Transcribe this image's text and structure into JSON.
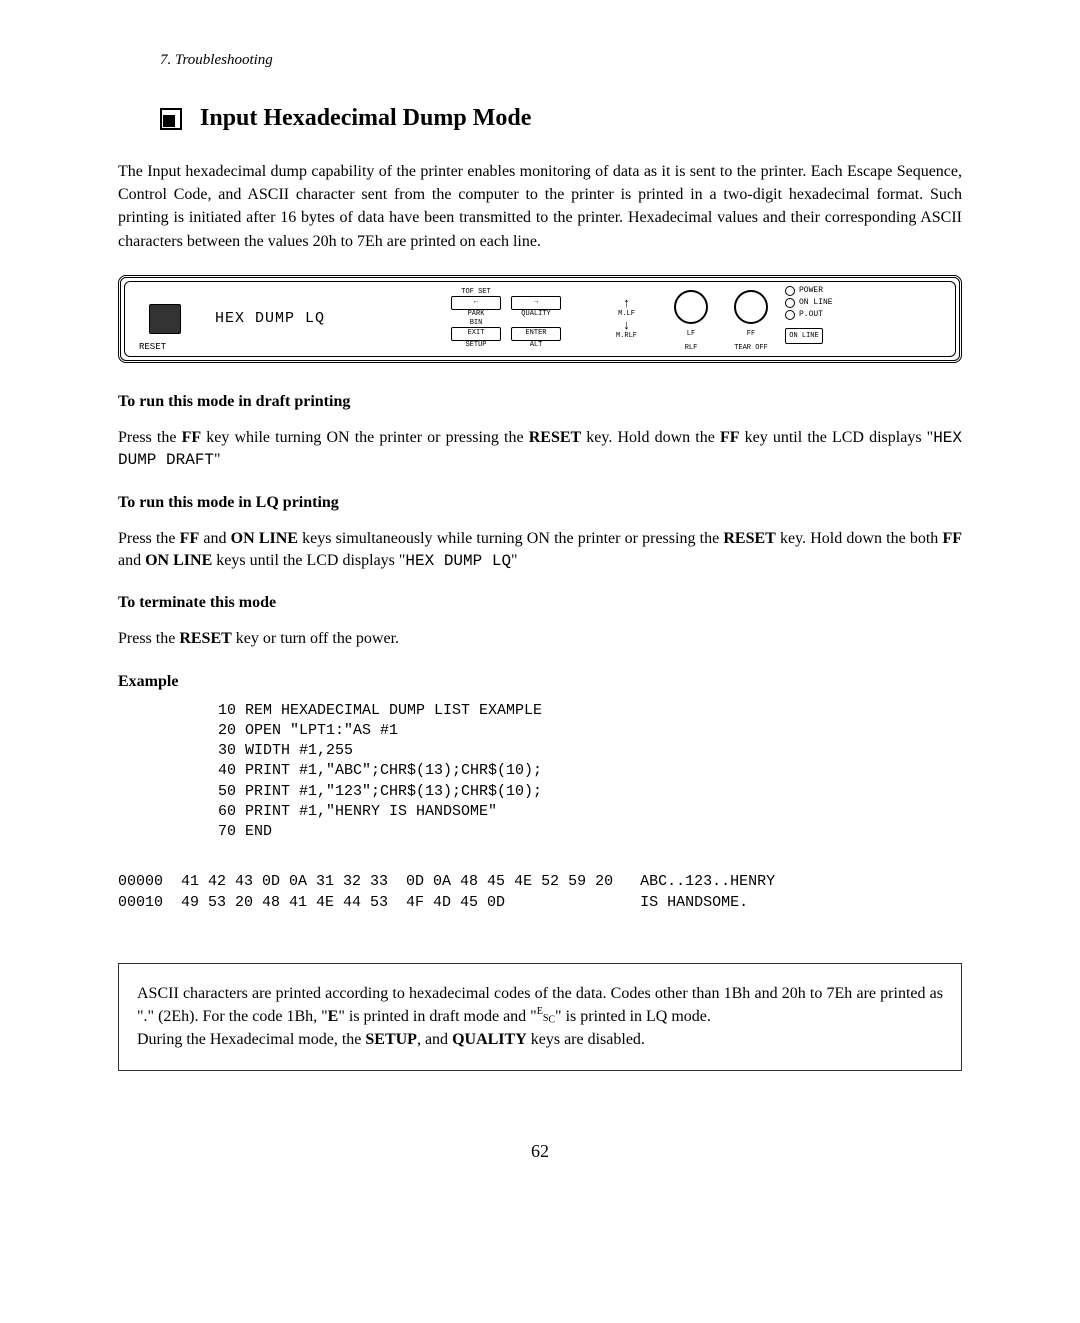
{
  "breadcrumb": "7. Troubleshooting",
  "title": "Input Hexadecimal Dump Mode",
  "intro": "The Input hexadecimal dump capability of the printer enables monitoring of data as it is sent to the printer.  Each Escape Sequence, Control Code, and ASCII character sent from the computer to the printer is printed in a two-digit hexadecimal format.  Such printing is initiated after 16 bytes of data have been transmitted to the printer.  Hexadecimal values and their corresponding ASCII characters between the values 20h to 7Eh are printed on each line.",
  "figure": {
    "reset_label": "RESET",
    "lcd": "HEX DUMP   LQ",
    "buttons": {
      "tof_set": "TOF SET",
      "left_arrow": "←",
      "right_arrow": "→",
      "park": "PARK",
      "quality": "QUALITY",
      "bin": "BIN",
      "exit": "EXIT",
      "enter": "ENTER",
      "setup": "SETUP",
      "alt": "ALT"
    },
    "arrows": {
      "up": "↑",
      "down": "↓",
      "mlf": "M.LF",
      "mrlf": "M.RLF"
    },
    "round": {
      "lf": "LF",
      "ff": "FF",
      "rlf": "RLF",
      "tearoff": "TEAR OFF",
      "online": "ON LINE"
    },
    "leds": {
      "power": "POWER",
      "online": "ON LINE",
      "pout": "P.OUT"
    }
  },
  "sections": {
    "draft_head": "To run this mode in draft printing",
    "draft_pre": "Press the ",
    "draft_ff": "FF",
    "draft_mid1": " key while turning ON the printer or pressing the ",
    "draft_reset": "RESET",
    "draft_mid2": " key.  Hold down the ",
    "draft_ff2": "FF",
    "draft_mid3": " key until the LCD displays \"",
    "draft_lcd": "HEX DUMP  DRAFT",
    "draft_end": "\"",
    "lq_head": "To run this mode in LQ printing",
    "lq_pre": "Press the ",
    "lq_ff": "FF",
    "lq_and": " and ",
    "lq_online": "ON LINE",
    "lq_mid1": " keys simultaneously while turning ON the printer or pressing the ",
    "lq_reset": "RESET",
    "lq_mid2": " key.  Hold down the both ",
    "lq_ff2": "FF",
    "lq_and2": " and ",
    "lq_online2": "ON LINE",
    "lq_mid3": " keys until the LCD displays \"",
    "lq_lcd": "HEX DUMP LQ",
    "lq_end": "\"",
    "term_head": "To terminate this mode",
    "term_pre": "Press the ",
    "term_reset": "RESET",
    "term_end": " key or turn off the power.",
    "example_head": "Example",
    "code": "10 REM HEXADECIMAL DUMP LIST EXAMPLE\n20 OPEN \"LPT1:\"AS #1\n30 WIDTH #1,255\n40 PRINT #1,\"ABC\";CHR$(13);CHR$(10);\n50 PRINT #1,\"123\";CHR$(13);CHR$(10);\n60 PRINT #1,\"HENRY IS HANDSOME\"\n70 END",
    "hex": "00000  41 42 43 0D 0A 31 32 33  0D 0A 48 45 4E 52 59 20   ABC..123..HENRY\n00010  49 53 20 48 41 4E 44 53  4F 4D 45 0D               IS HANDSOME."
  },
  "note": {
    "l1a": "ASCII characters are printed according to hexadecimal codes of the data.  Codes other than 1Bh and 20h to 7Eh are printed as \".\" (2Eh).  For the code 1Bh, \"",
    "l1b": "E",
    "l1c": "\" is printed in draft mode and \"",
    "l1d": "E",
    "l1e": "S",
    "l1f": "C",
    "l1g": "\" is printed in LQ mode.",
    "l2a": "During the Hexadecimal mode, the ",
    "l2b": "SETUP",
    "l2c": ", and ",
    "l2d": "QUALITY",
    "l2e": " keys are disabled."
  },
  "page_number": "62"
}
